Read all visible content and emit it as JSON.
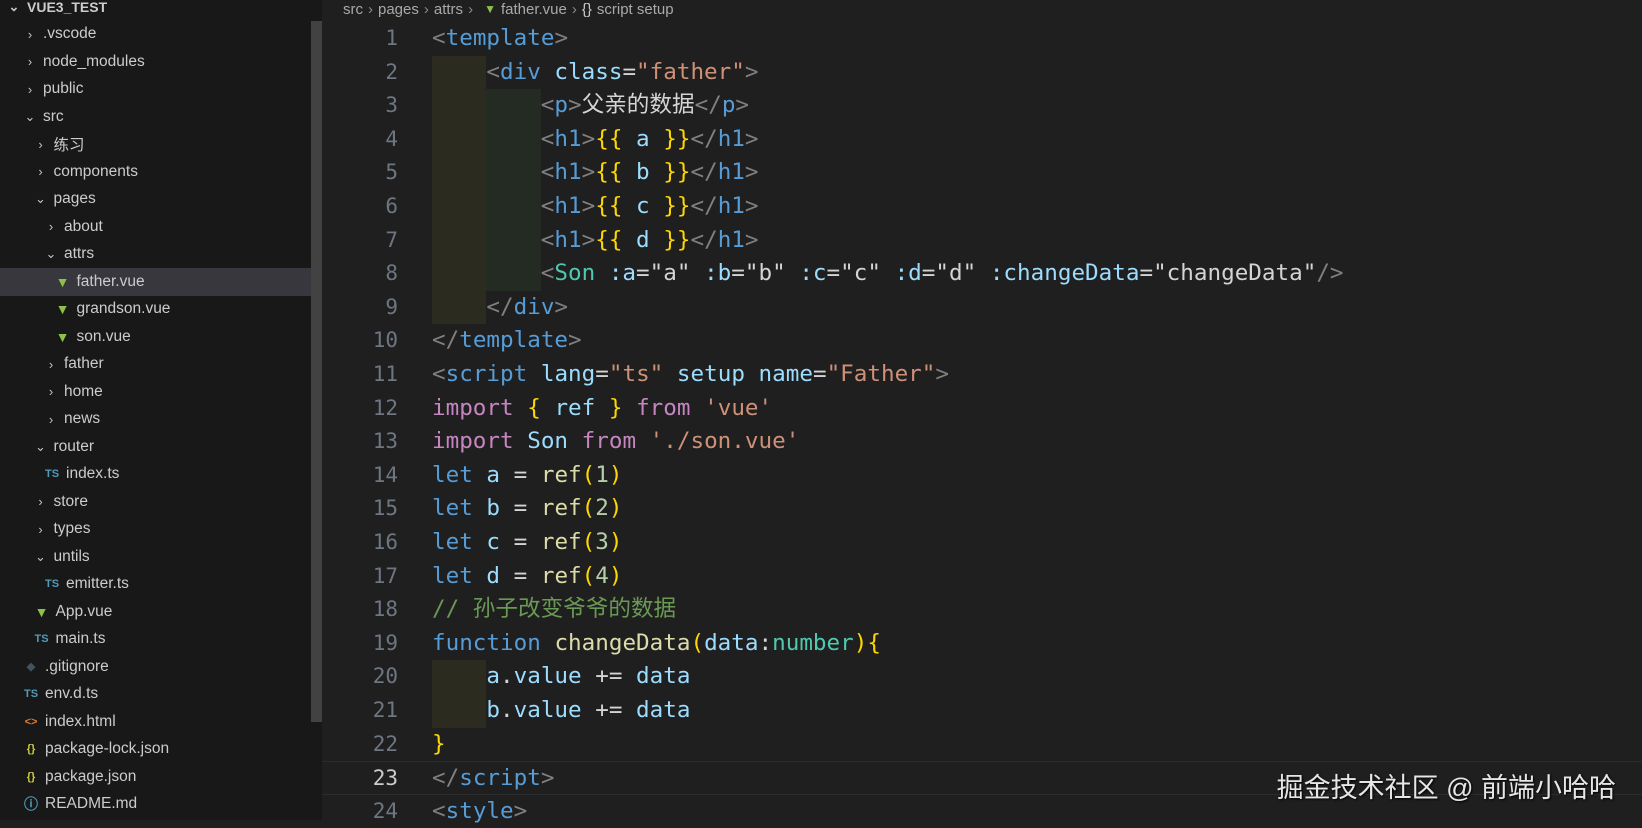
{
  "explorer": {
    "root": "VUE3_TEST",
    "items": [
      {
        "label": ".vscode",
        "depth": 0,
        "kind": "folder",
        "open": false
      },
      {
        "label": "node_modules",
        "depth": 0,
        "kind": "folder",
        "open": false
      },
      {
        "label": "public",
        "depth": 0,
        "kind": "folder",
        "open": false
      },
      {
        "label": "src",
        "depth": 0,
        "kind": "folder",
        "open": true
      },
      {
        "label": "练习",
        "depth": 1,
        "kind": "folder",
        "open": false
      },
      {
        "label": "components",
        "depth": 1,
        "kind": "folder",
        "open": false
      },
      {
        "label": "pages",
        "depth": 1,
        "kind": "folder",
        "open": true
      },
      {
        "label": "about",
        "depth": 2,
        "kind": "folder",
        "open": false
      },
      {
        "label": "attrs",
        "depth": 2,
        "kind": "folder",
        "open": true
      },
      {
        "label": "father.vue",
        "depth": 3,
        "kind": "vue",
        "selected": true
      },
      {
        "label": "grandson.vue",
        "depth": 3,
        "kind": "vue"
      },
      {
        "label": "son.vue",
        "depth": 3,
        "kind": "vue"
      },
      {
        "label": "father",
        "depth": 2,
        "kind": "folder",
        "open": false
      },
      {
        "label": "home",
        "depth": 2,
        "kind": "folder",
        "open": false
      },
      {
        "label": "news",
        "depth": 2,
        "kind": "folder",
        "open": false
      },
      {
        "label": "router",
        "depth": 1,
        "kind": "folder",
        "open": true
      },
      {
        "label": "index.ts",
        "depth": 2,
        "kind": "ts"
      },
      {
        "label": "store",
        "depth": 1,
        "kind": "folder",
        "open": false
      },
      {
        "label": "types",
        "depth": 1,
        "kind": "folder",
        "open": false
      },
      {
        "label": "untils",
        "depth": 1,
        "kind": "folder",
        "open": true
      },
      {
        "label": "emitter.ts",
        "depth": 2,
        "kind": "ts"
      },
      {
        "label": "App.vue",
        "depth": 1,
        "kind": "vue"
      },
      {
        "label": "main.ts",
        "depth": 1,
        "kind": "ts"
      },
      {
        "label": ".gitignore",
        "depth": 0,
        "kind": "git"
      },
      {
        "label": "env.d.ts",
        "depth": 0,
        "kind": "ts"
      },
      {
        "label": "index.html",
        "depth": 0,
        "kind": "html"
      },
      {
        "label": "package-lock.json",
        "depth": 0,
        "kind": "json"
      },
      {
        "label": "package.json",
        "depth": 0,
        "kind": "json"
      },
      {
        "label": "README.md",
        "depth": 0,
        "kind": "info"
      }
    ]
  },
  "breadcrumb": [
    "src",
    "pages",
    "attrs",
    "father.vue",
    "script setup"
  ],
  "icons": {
    "ts": "TS",
    "json": "{}",
    "html": "<>",
    "info": "ⓘ",
    "git": "◆",
    "vue": "▼",
    "braces": "{}"
  },
  "colors": {
    "vue": "#8dc149",
    "ts": "#519aba",
    "json": "#cbcb41",
    "html": "#e37933",
    "git": "#41535b",
    "info": "#519aba"
  },
  "editor": {
    "current_line": 23,
    "lines": [
      {
        "n": "1",
        "indent": 0,
        "tokens": [
          [
            "<",
            "punc"
          ],
          [
            "template",
            "tag"
          ],
          [
            ">",
            "punc"
          ]
        ]
      },
      {
        "n": "2",
        "indent": 1,
        "tokens": [
          [
            "<",
            "punc"
          ],
          [
            "div",
            "tag"
          ],
          [
            " ",
            "text"
          ],
          [
            "class",
            "attr"
          ],
          [
            "=",
            "text"
          ],
          [
            "\"father\"",
            "str"
          ],
          [
            ">",
            "punc"
          ]
        ]
      },
      {
        "n": "3",
        "indent": 2,
        "tokens": [
          [
            "<",
            "punc"
          ],
          [
            "p",
            "tag"
          ],
          [
            ">",
            "punc"
          ],
          [
            "父亲的数据",
            "text"
          ],
          [
            "</",
            "punc"
          ],
          [
            "p",
            "tag"
          ],
          [
            ">",
            "punc"
          ]
        ]
      },
      {
        "n": "4",
        "indent": 2,
        "tokens": [
          [
            "<",
            "punc"
          ],
          [
            "h1",
            "tag"
          ],
          [
            ">",
            "punc"
          ],
          [
            "{{",
            "brace"
          ],
          [
            " a ",
            "var"
          ],
          [
            "}}",
            "brace"
          ],
          [
            "</",
            "punc"
          ],
          [
            "h1",
            "tag"
          ],
          [
            ">",
            "punc"
          ]
        ]
      },
      {
        "n": "5",
        "indent": 2,
        "tokens": [
          [
            "<",
            "punc"
          ],
          [
            "h1",
            "tag"
          ],
          [
            ">",
            "punc"
          ],
          [
            "{{",
            "brace"
          ],
          [
            " b ",
            "var"
          ],
          [
            "}}",
            "brace"
          ],
          [
            "</",
            "punc"
          ],
          [
            "h1",
            "tag"
          ],
          [
            ">",
            "punc"
          ]
        ]
      },
      {
        "n": "6",
        "indent": 2,
        "tokens": [
          [
            "<",
            "punc"
          ],
          [
            "h1",
            "tag"
          ],
          [
            ">",
            "punc"
          ],
          [
            "{{",
            "brace"
          ],
          [
            " c ",
            "var"
          ],
          [
            "}}",
            "brace"
          ],
          [
            "</",
            "punc"
          ],
          [
            "h1",
            "tag"
          ],
          [
            ">",
            "punc"
          ]
        ]
      },
      {
        "n": "7",
        "indent": 2,
        "tokens": [
          [
            "<",
            "punc"
          ],
          [
            "h1",
            "tag"
          ],
          [
            ">",
            "punc"
          ],
          [
            "{{",
            "brace"
          ],
          [
            " d ",
            "var"
          ],
          [
            "}}",
            "brace"
          ],
          [
            "</",
            "punc"
          ],
          [
            "h1",
            "tag"
          ],
          [
            ">",
            "punc"
          ]
        ]
      },
      {
        "n": "8",
        "indent": 2,
        "tokens": [
          [
            "<",
            "punc"
          ],
          [
            "Son",
            "type"
          ],
          [
            " ",
            "text"
          ],
          [
            ":a",
            "attr"
          ],
          [
            "=",
            "text"
          ],
          [
            "\"a\"",
            "text"
          ],
          [
            " ",
            "text"
          ],
          [
            ":b",
            "attr"
          ],
          [
            "=",
            "text"
          ],
          [
            "\"b\"",
            "text"
          ],
          [
            " ",
            "text"
          ],
          [
            ":c",
            "attr"
          ],
          [
            "=",
            "text"
          ],
          [
            "\"c\"",
            "text"
          ],
          [
            " ",
            "text"
          ],
          [
            ":d",
            "attr"
          ],
          [
            "=",
            "text"
          ],
          [
            "\"d\"",
            "text"
          ],
          [
            " ",
            "text"
          ],
          [
            ":changeData",
            "attr"
          ],
          [
            "=",
            "text"
          ],
          [
            "\"changeData\"",
            "text"
          ],
          [
            "/>",
            "punc"
          ]
        ]
      },
      {
        "n": "9",
        "indent": 1,
        "tokens": [
          [
            "</",
            "punc"
          ],
          [
            "div",
            "tag"
          ],
          [
            ">",
            "punc"
          ]
        ]
      },
      {
        "n": "10",
        "indent": 0,
        "tokens": [
          [
            "</",
            "punc"
          ],
          [
            "template",
            "tag"
          ],
          [
            ">",
            "punc"
          ]
        ]
      },
      {
        "n": "11",
        "indent": 0,
        "tokens": [
          [
            "<",
            "punc"
          ],
          [
            "script",
            "tag"
          ],
          [
            " ",
            "text"
          ],
          [
            "lang",
            "attr"
          ],
          [
            "=",
            "text"
          ],
          [
            "\"ts\"",
            "str"
          ],
          [
            " ",
            "text"
          ],
          [
            "setup",
            "attr"
          ],
          [
            " ",
            "text"
          ],
          [
            "name",
            "attr"
          ],
          [
            "=",
            "text"
          ],
          [
            "\"Father\"",
            "str"
          ],
          [
            ">",
            "punc"
          ]
        ]
      },
      {
        "n": "12",
        "indent": 0,
        "tokens": [
          [
            "import",
            "kw"
          ],
          [
            " ",
            "text"
          ],
          [
            "{",
            "brace"
          ],
          [
            " ref ",
            "var"
          ],
          [
            "}",
            "brace"
          ],
          [
            " ",
            "text"
          ],
          [
            "from",
            "kw"
          ],
          [
            " ",
            "text"
          ],
          [
            "'vue'",
            "str"
          ]
        ]
      },
      {
        "n": "13",
        "indent": 0,
        "tokens": [
          [
            "import",
            "kw"
          ],
          [
            " Son ",
            "var"
          ],
          [
            "from",
            "kw"
          ],
          [
            " ",
            "text"
          ],
          [
            "'./son.vue'",
            "str"
          ]
        ]
      },
      {
        "n": "14",
        "indent": 0,
        "tokens": [
          [
            "let",
            "decl"
          ],
          [
            " a ",
            "var"
          ],
          [
            "=",
            "text"
          ],
          [
            " ",
            "text"
          ],
          [
            "ref",
            "fn"
          ],
          [
            "(",
            "brace"
          ],
          [
            "1",
            "num"
          ],
          [
            ")",
            "brace"
          ]
        ]
      },
      {
        "n": "15",
        "indent": 0,
        "tokens": [
          [
            "let",
            "decl"
          ],
          [
            " b ",
            "var"
          ],
          [
            "=",
            "text"
          ],
          [
            " ",
            "text"
          ],
          [
            "ref",
            "fn"
          ],
          [
            "(",
            "brace"
          ],
          [
            "2",
            "num"
          ],
          [
            ")",
            "brace"
          ]
        ]
      },
      {
        "n": "16",
        "indent": 0,
        "tokens": [
          [
            "let",
            "decl"
          ],
          [
            " c ",
            "var"
          ],
          [
            "=",
            "text"
          ],
          [
            " ",
            "text"
          ],
          [
            "ref",
            "fn"
          ],
          [
            "(",
            "brace"
          ],
          [
            "3",
            "num"
          ],
          [
            ")",
            "brace"
          ]
        ]
      },
      {
        "n": "17",
        "indent": 0,
        "tokens": [
          [
            "let",
            "decl"
          ],
          [
            " d ",
            "var"
          ],
          [
            "=",
            "text"
          ],
          [
            " ",
            "text"
          ],
          [
            "ref",
            "fn"
          ],
          [
            "(",
            "brace"
          ],
          [
            "4",
            "num"
          ],
          [
            ")",
            "brace"
          ]
        ]
      },
      {
        "n": "18",
        "indent": 0,
        "tokens": [
          [
            "// 孙子改变爷爷的数据",
            "com"
          ]
        ]
      },
      {
        "n": "19",
        "indent": 0,
        "tokens": [
          [
            "function",
            "decl"
          ],
          [
            " ",
            "text"
          ],
          [
            "changeData",
            "fn"
          ],
          [
            "(",
            "brace"
          ],
          [
            "data",
            "var"
          ],
          [
            ":",
            "text"
          ],
          [
            "number",
            "type"
          ],
          [
            ")",
            "brace"
          ],
          [
            "{",
            "brace"
          ]
        ]
      },
      {
        "n": "20",
        "indent": 1,
        "tokens": [
          [
            "a",
            "var"
          ],
          [
            ".",
            "text"
          ],
          [
            "value",
            "var"
          ],
          [
            " += ",
            "text"
          ],
          [
            "data",
            "var"
          ]
        ]
      },
      {
        "n": "21",
        "indent": 1,
        "tokens": [
          [
            "b",
            "var"
          ],
          [
            ".",
            "text"
          ],
          [
            "value",
            "var"
          ],
          [
            " += ",
            "text"
          ],
          [
            "data",
            "var"
          ]
        ]
      },
      {
        "n": "22",
        "indent": 0,
        "tokens": [
          [
            "}",
            "brace"
          ]
        ]
      },
      {
        "n": "23",
        "indent": 0,
        "tokens": [
          [
            "</",
            "punc"
          ],
          [
            "script",
            "tag"
          ],
          [
            ">",
            "punc"
          ]
        ]
      },
      {
        "n": "24",
        "indent": 0,
        "tokens": [
          [
            "<",
            "punc"
          ],
          [
            "style",
            "tag"
          ],
          [
            ">",
            "punc"
          ]
        ]
      }
    ]
  },
  "watermark": "掘金技术社区 @ 前端小哈哈"
}
